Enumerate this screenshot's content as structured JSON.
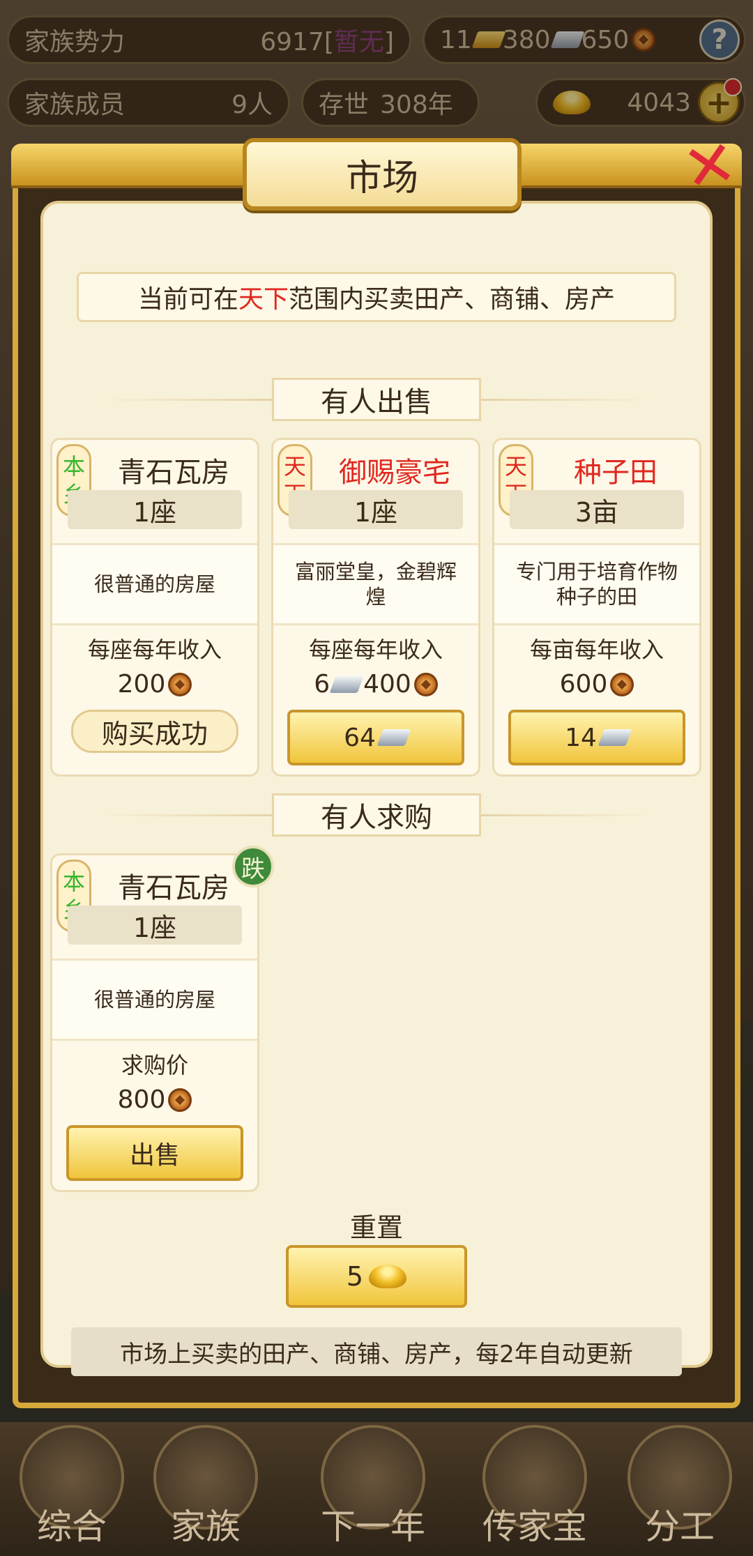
{
  "status_bar": {
    "power_label": "家族势力",
    "power_value": "6917",
    "power_rank": "暂无",
    "gold_bars": "11",
    "silver": "380",
    "coins": "650",
    "members_label": "家族成员",
    "members_value": "9人",
    "age_label": "存世",
    "age_value": "308年",
    "ingots": "4043"
  },
  "modal": {
    "title": "市场",
    "scope_prefix": "当前可在",
    "scope_highlight": "天下",
    "scope_suffix": "范围内买卖田产、商铺、房产"
  },
  "for_sale": {
    "heading": "有人出售",
    "items": [
      {
        "scope": [
          "本",
          "乡"
        ],
        "name": "青石瓦房",
        "qty": "1座",
        "desc": "很普通的房屋",
        "income_label": "每座每年收入",
        "income_silver": "",
        "income_coins": "200",
        "action": "购买成功"
      },
      {
        "scope": [
          "天",
          "下"
        ],
        "name": "御赐豪宅",
        "qty": "1座",
        "desc": "富丽堂皇，金碧辉煌",
        "income_label": "每座每年收入",
        "income_silver": "6",
        "income_coins": "400",
        "price_silver": "64"
      },
      {
        "scope": [
          "天",
          "下"
        ],
        "name": "种子田",
        "qty": "3亩",
        "desc": "专门用于培育作物种子的田",
        "income_label": "每亩每年收入",
        "income_coins": "600",
        "price_silver": "14"
      }
    ]
  },
  "wanted": {
    "heading": "有人求购",
    "items": [
      {
        "scope": [
          "本",
          "乡"
        ],
        "name": "青石瓦房",
        "badge": "跌",
        "qty": "1座",
        "desc": "很普通的房屋",
        "price_label": "求购价",
        "price_coins": "800",
        "action": "出售"
      }
    ]
  },
  "reset": {
    "label": "重置",
    "cost": "5"
  },
  "footer_note": "市场上买卖的田产、商铺、房产，每2年自动更新",
  "nav": [
    "综合",
    "家族",
    "下一年",
    "传家宝",
    "分工"
  ]
}
